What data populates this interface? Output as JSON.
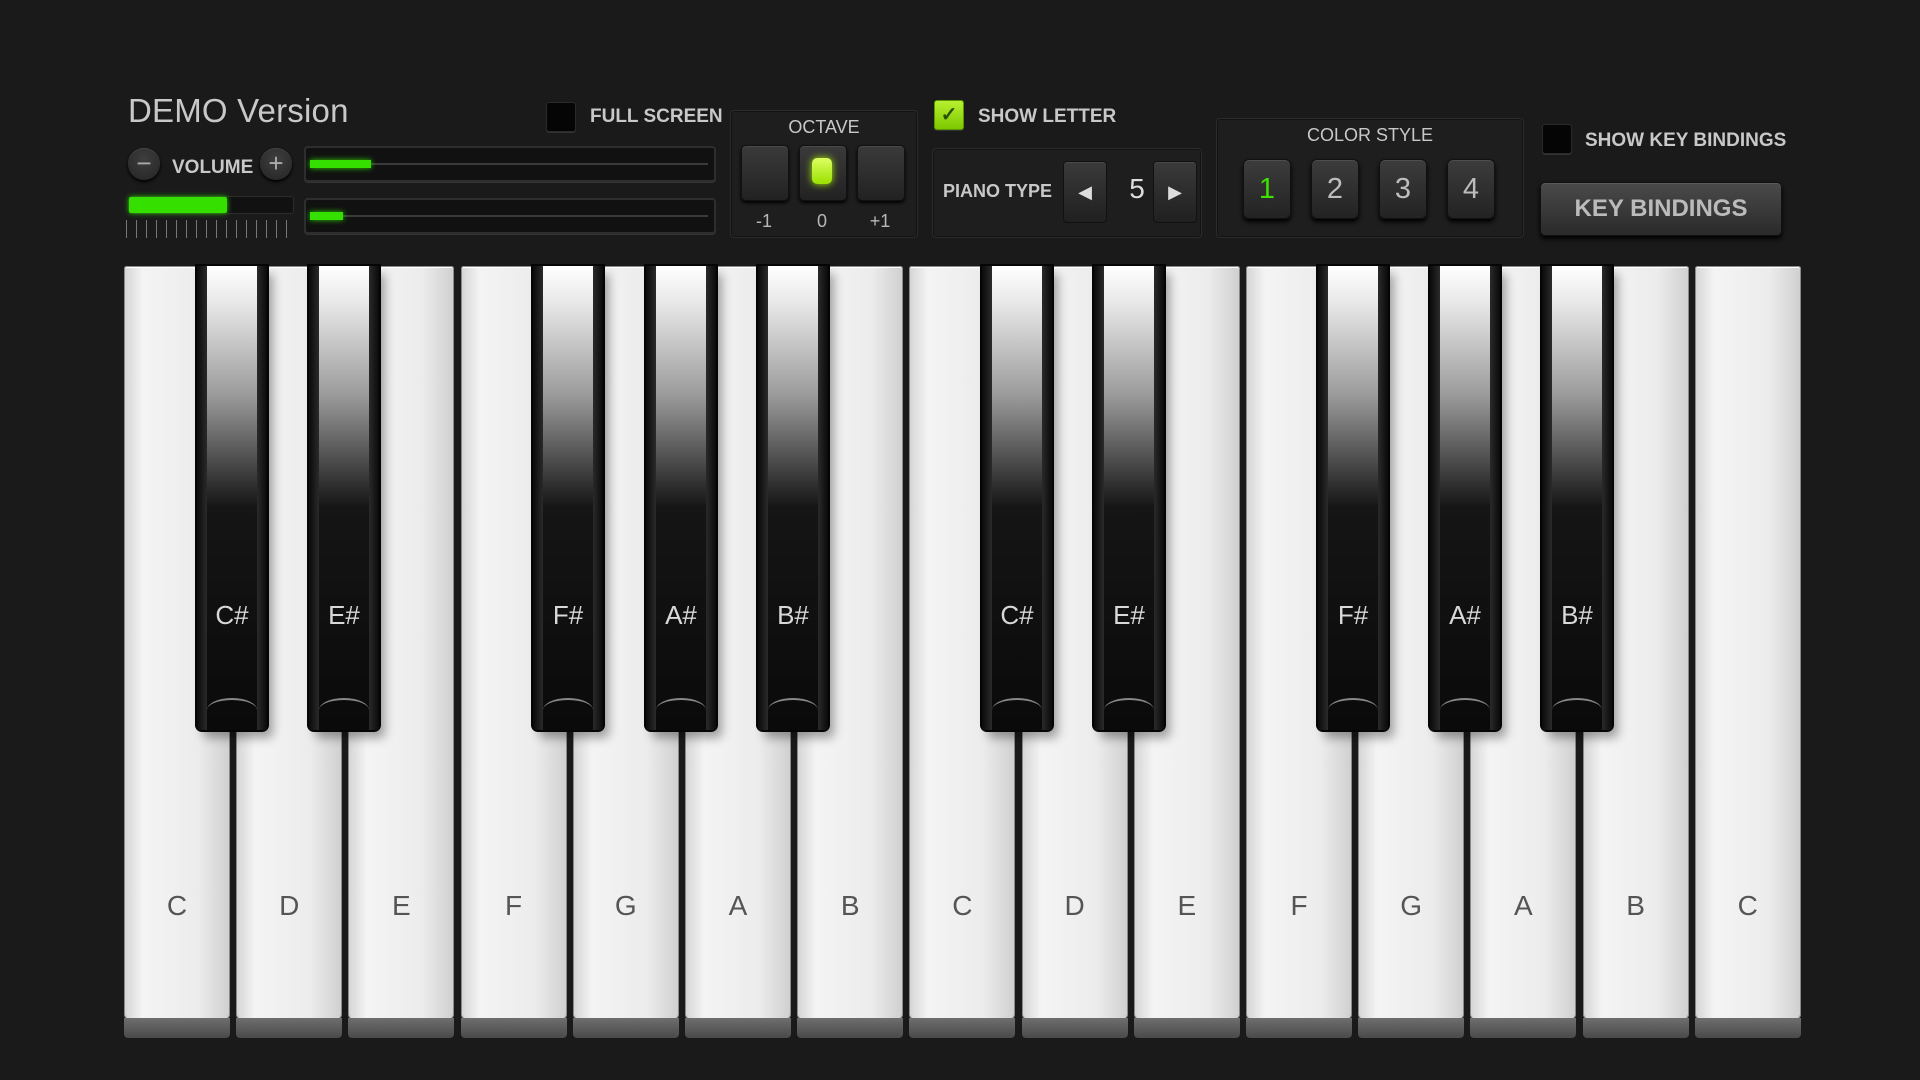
{
  "header": {
    "title": "DEMO Version",
    "volume_label": "VOLUME",
    "volume_minus": "−",
    "volume_plus": "+",
    "volume_level": 0.6,
    "slider1_level": 0.15,
    "slider2_level": 0.08,
    "full_screen_label": "FULL SCREEN",
    "full_screen_checked": false
  },
  "octave": {
    "label": "OCTAVE",
    "options": [
      "-1",
      "0",
      "+1"
    ],
    "selected": "0"
  },
  "show_letter": {
    "label": "SHOW LETTER",
    "checked": true,
    "check_glyph": "✓"
  },
  "piano_type": {
    "label": "PIANO TYPE",
    "value": "5",
    "prev_icon": "◀",
    "next_icon": "▶"
  },
  "color_style": {
    "label": "COLOR STYLE",
    "options": [
      "1",
      "2",
      "3",
      "4"
    ],
    "selected": "1"
  },
  "show_key_bindings": {
    "label": "SHOW KEY BINDINGS",
    "checked": false
  },
  "key_bindings_button": "KEY BINDINGS",
  "colors": {
    "accent": "#35e000",
    "background": "#1a1a1a"
  },
  "keyboard": {
    "white_keys": [
      "C",
      "D",
      "E",
      "F",
      "G",
      "A",
      "B",
      "C",
      "D",
      "E",
      "F",
      "G",
      "A",
      "B",
      "C"
    ],
    "black_keys": [
      "C#",
      "E#",
      "F#",
      "A#",
      "B#",
      "C#",
      "E#",
      "F#",
      "A#",
      "B#"
    ]
  }
}
